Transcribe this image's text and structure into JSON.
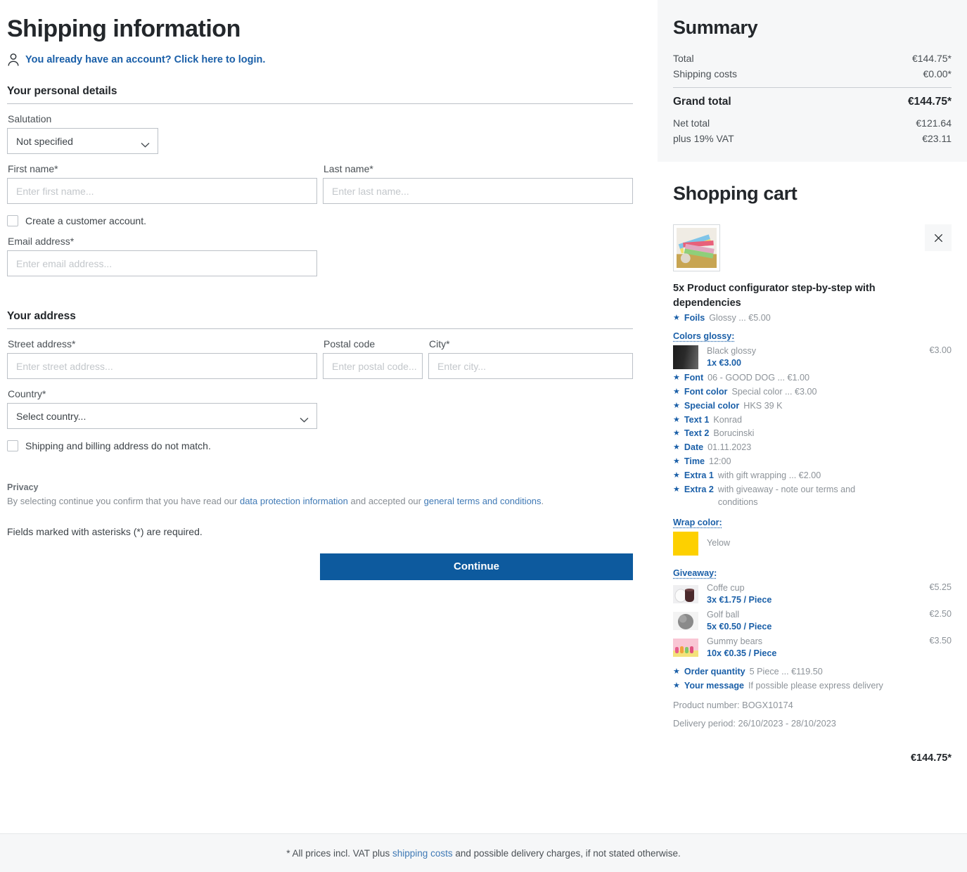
{
  "shipping": {
    "title": "Shipping information",
    "login_link": "You already have an account? Click here to login.",
    "login_icon": "user-icon",
    "personal_details_heading": "Your personal details",
    "salutation_label": "Salutation",
    "salutation_value": "Not specified",
    "first_name_label": "First name*",
    "first_name_placeholder": "Enter first name...",
    "last_name_label": "Last name*",
    "last_name_placeholder": "Enter last name...",
    "create_account_label": "Create a customer account.",
    "email_label": "Email address*",
    "email_placeholder": "Enter email address...",
    "address_heading": "Your address",
    "street_label": "Street address*",
    "street_placeholder": "Enter street address...",
    "postal_label": "Postal code",
    "postal_placeholder": "Enter postal code...",
    "city_label": "City*",
    "city_placeholder": "Enter city...",
    "country_label": "Country*",
    "country_value": "Select country...",
    "billing_mismatch_label": "Shipping and billing address do not match.",
    "privacy_heading": "Privacy",
    "privacy_text_1": "By selecting continue you confirm that you have read our ",
    "privacy_link_1": "data protection information",
    "privacy_text_2": " and accepted our ",
    "privacy_link_2": "general terms and conditions",
    "privacy_text_3": ".",
    "required_note": "Fields marked with asterisks (*) are required.",
    "continue_label": "Continue"
  },
  "summary": {
    "title": "Summary",
    "rows": [
      {
        "label": "Total",
        "value": "€144.75*"
      },
      {
        "label": "Shipping costs",
        "value": "€0.00*"
      }
    ],
    "grand_total_label": "Grand total",
    "grand_total_value": "€144.75*",
    "net_rows": [
      {
        "label": "Net total",
        "value": "€121.64"
      },
      {
        "label": "plus 19% VAT",
        "value": "€23.11"
      }
    ]
  },
  "cart": {
    "title": "Shopping cart",
    "close_icon": "close-icon",
    "item": {
      "thumbnail_icon": "color-fan-thumbnail",
      "name": "5x Product configurator step-by-step with dependencies",
      "options_top": [
        {
          "key": "Foils",
          "value": "Glossy ... €5.00"
        }
      ],
      "colors_glossy_heading": "Colors glossy:",
      "colors_glossy": [
        {
          "swatch": "black-glossy-swatch",
          "name": "Black glossy",
          "qty": "1x €3.00",
          "price": "€3.00"
        }
      ],
      "options_mid": [
        {
          "key": "Font",
          "value": "06 - GOOD DOG ... €1.00"
        },
        {
          "key": "Font color",
          "value": "Special color ... €3.00"
        },
        {
          "key": "Special color",
          "value": "HKS 39 K"
        },
        {
          "key": "Text 1",
          "value": "Konrad"
        },
        {
          "key": "Text 2",
          "value": "Borucinski"
        },
        {
          "key": "Date",
          "value": "01.11.2023"
        },
        {
          "key": "Time",
          "value": "12:00"
        },
        {
          "key": "Extra 1",
          "value": "with gift wrapping ... €2.00"
        },
        {
          "key": "Extra 2",
          "value": "with giveaway - note our terms and conditions"
        }
      ],
      "wrap_color_heading": "Wrap color:",
      "wrap_colors": [
        {
          "swatch": "yellow-swatch",
          "name": "Yelow",
          "color": "#fdd000"
        }
      ],
      "giveaway_heading": "Giveaway:",
      "giveaways": [
        {
          "thumbnail": "coffee-cup-thumbnail",
          "name": "Coffe cup",
          "qty": "3x €1.75 / Piece",
          "price": "€5.25"
        },
        {
          "thumbnail": "golf-ball-thumbnail",
          "name": "Golf ball",
          "qty": "5x €0.50 / Piece",
          "price": "€2.50"
        },
        {
          "thumbnail": "gummy-bears-thumbnail",
          "name": "Gummy bears",
          "qty": "10x €0.35 / Piece",
          "price": "€3.50"
        }
      ],
      "options_bottom": [
        {
          "key": "Order quantity",
          "value": "5 Piece ... €119.50"
        },
        {
          "key": "Your message",
          "value": "If possible please express delivery"
        }
      ],
      "product_number": "Product number: BOGX10174",
      "delivery_period": "Delivery period: 26/10/2023 - 28/10/2023",
      "item_total": "€144.75*"
    }
  },
  "footer": {
    "text_1": "* All prices incl. VAT plus ",
    "link": "shipping costs",
    "text_2": " and possible delivery charges, if not stated otherwise."
  },
  "colors": {
    "primary_blue": "#0d5a9e",
    "link_blue": "#1a5fa8",
    "panel_gray": "#f6f7f8",
    "text_dark": "#23272b",
    "text_muted": "#8d9399"
  }
}
